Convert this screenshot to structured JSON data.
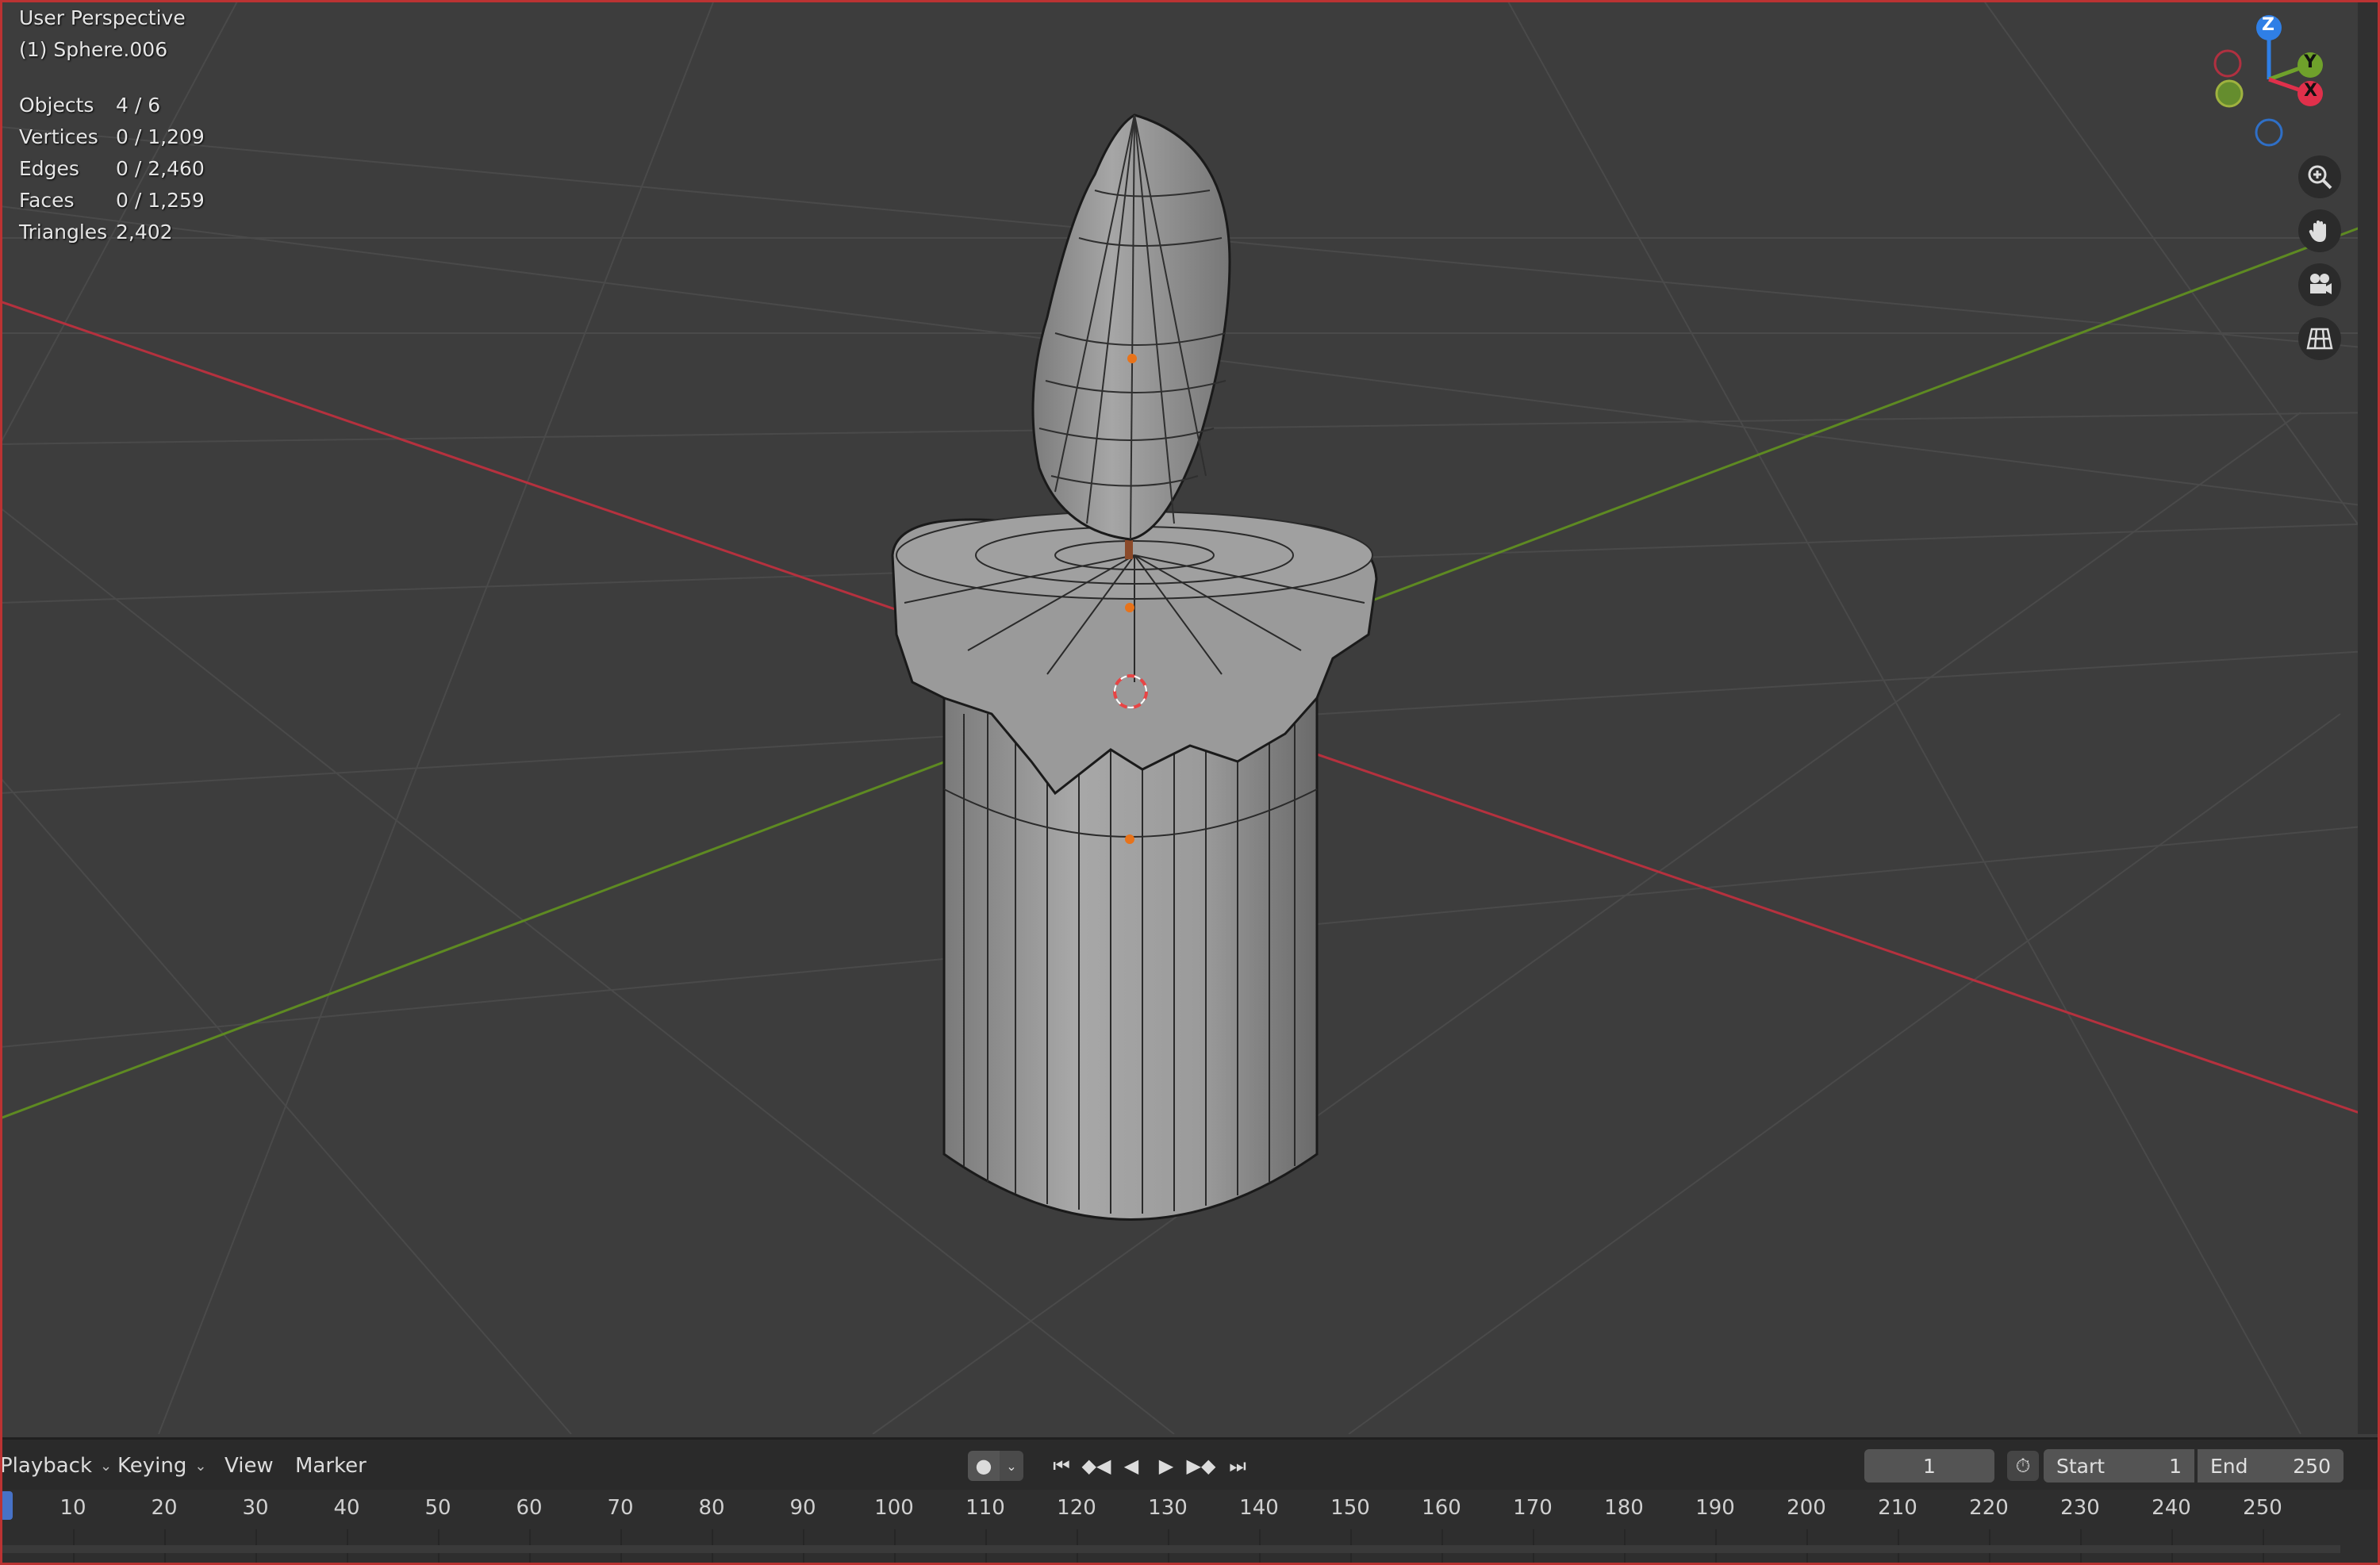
{
  "viewport": {
    "view_name": "User Perspective",
    "active_object": "(1) Sphere.006",
    "stats": [
      {
        "label": "Objects",
        "value": "4 / 6"
      },
      {
        "label": "Vertices",
        "value": "0 / 1,209"
      },
      {
        "label": "Edges",
        "value": "0 / 2,460"
      },
      {
        "label": "Faces",
        "value": "0 / 1,259"
      },
      {
        "label": "Triangles",
        "value": "2,402"
      }
    ],
    "gizmo": {
      "z": "Z",
      "y": "Y",
      "x": "X"
    },
    "colors": {
      "x_axis": "#e0304b",
      "y_axis": "#6fa12b",
      "z_axis": "#2f7fe6",
      "background": "#3d3d3d"
    }
  },
  "timeline": {
    "menus": [
      "Playback",
      "Keying",
      "View",
      "Marker"
    ],
    "current_frame": "1",
    "start_label": "Start",
    "start_value": "1",
    "end_label": "End",
    "end_value": "250",
    "ticks": [
      "10",
      "20",
      "30",
      "40",
      "50",
      "60",
      "70",
      "80",
      "90",
      "100",
      "110",
      "120",
      "130",
      "140",
      "150",
      "160",
      "170",
      "180",
      "190",
      "200",
      "210",
      "220",
      "230",
      "240",
      "250"
    ]
  }
}
